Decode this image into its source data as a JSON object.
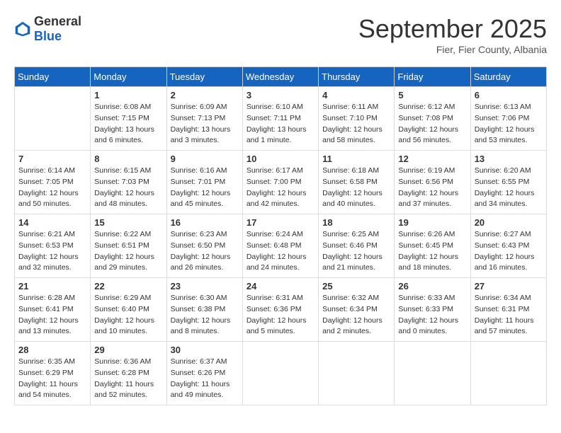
{
  "header": {
    "logo_general": "General",
    "logo_blue": "Blue",
    "month": "September 2025",
    "location": "Fier, Fier County, Albania"
  },
  "days_of_week": [
    "Sunday",
    "Monday",
    "Tuesday",
    "Wednesday",
    "Thursday",
    "Friday",
    "Saturday"
  ],
  "weeks": [
    [
      {
        "day": "",
        "info": ""
      },
      {
        "day": "1",
        "info": "Sunrise: 6:08 AM\nSunset: 7:15 PM\nDaylight: 13 hours\nand 6 minutes."
      },
      {
        "day": "2",
        "info": "Sunrise: 6:09 AM\nSunset: 7:13 PM\nDaylight: 13 hours\nand 3 minutes."
      },
      {
        "day": "3",
        "info": "Sunrise: 6:10 AM\nSunset: 7:11 PM\nDaylight: 13 hours\nand 1 minute."
      },
      {
        "day": "4",
        "info": "Sunrise: 6:11 AM\nSunset: 7:10 PM\nDaylight: 12 hours\nand 58 minutes."
      },
      {
        "day": "5",
        "info": "Sunrise: 6:12 AM\nSunset: 7:08 PM\nDaylight: 12 hours\nand 56 minutes."
      },
      {
        "day": "6",
        "info": "Sunrise: 6:13 AM\nSunset: 7:06 PM\nDaylight: 12 hours\nand 53 minutes."
      }
    ],
    [
      {
        "day": "7",
        "info": "Sunrise: 6:14 AM\nSunset: 7:05 PM\nDaylight: 12 hours\nand 50 minutes."
      },
      {
        "day": "8",
        "info": "Sunrise: 6:15 AM\nSunset: 7:03 PM\nDaylight: 12 hours\nand 48 minutes."
      },
      {
        "day": "9",
        "info": "Sunrise: 6:16 AM\nSunset: 7:01 PM\nDaylight: 12 hours\nand 45 minutes."
      },
      {
        "day": "10",
        "info": "Sunrise: 6:17 AM\nSunset: 7:00 PM\nDaylight: 12 hours\nand 42 minutes."
      },
      {
        "day": "11",
        "info": "Sunrise: 6:18 AM\nSunset: 6:58 PM\nDaylight: 12 hours\nand 40 minutes."
      },
      {
        "day": "12",
        "info": "Sunrise: 6:19 AM\nSunset: 6:56 PM\nDaylight: 12 hours\nand 37 minutes."
      },
      {
        "day": "13",
        "info": "Sunrise: 6:20 AM\nSunset: 6:55 PM\nDaylight: 12 hours\nand 34 minutes."
      }
    ],
    [
      {
        "day": "14",
        "info": "Sunrise: 6:21 AM\nSunset: 6:53 PM\nDaylight: 12 hours\nand 32 minutes."
      },
      {
        "day": "15",
        "info": "Sunrise: 6:22 AM\nSunset: 6:51 PM\nDaylight: 12 hours\nand 29 minutes."
      },
      {
        "day": "16",
        "info": "Sunrise: 6:23 AM\nSunset: 6:50 PM\nDaylight: 12 hours\nand 26 minutes."
      },
      {
        "day": "17",
        "info": "Sunrise: 6:24 AM\nSunset: 6:48 PM\nDaylight: 12 hours\nand 24 minutes."
      },
      {
        "day": "18",
        "info": "Sunrise: 6:25 AM\nSunset: 6:46 PM\nDaylight: 12 hours\nand 21 minutes."
      },
      {
        "day": "19",
        "info": "Sunrise: 6:26 AM\nSunset: 6:45 PM\nDaylight: 12 hours\nand 18 minutes."
      },
      {
        "day": "20",
        "info": "Sunrise: 6:27 AM\nSunset: 6:43 PM\nDaylight: 12 hours\nand 16 minutes."
      }
    ],
    [
      {
        "day": "21",
        "info": "Sunrise: 6:28 AM\nSunset: 6:41 PM\nDaylight: 12 hours\nand 13 minutes."
      },
      {
        "day": "22",
        "info": "Sunrise: 6:29 AM\nSunset: 6:40 PM\nDaylight: 12 hours\nand 10 minutes."
      },
      {
        "day": "23",
        "info": "Sunrise: 6:30 AM\nSunset: 6:38 PM\nDaylight: 12 hours\nand 8 minutes."
      },
      {
        "day": "24",
        "info": "Sunrise: 6:31 AM\nSunset: 6:36 PM\nDaylight: 12 hours\nand 5 minutes."
      },
      {
        "day": "25",
        "info": "Sunrise: 6:32 AM\nSunset: 6:34 PM\nDaylight: 12 hours\nand 2 minutes."
      },
      {
        "day": "26",
        "info": "Sunrise: 6:33 AM\nSunset: 6:33 PM\nDaylight: 12 hours\nand 0 minutes."
      },
      {
        "day": "27",
        "info": "Sunrise: 6:34 AM\nSunset: 6:31 PM\nDaylight: 11 hours\nand 57 minutes."
      }
    ],
    [
      {
        "day": "28",
        "info": "Sunrise: 6:35 AM\nSunset: 6:29 PM\nDaylight: 11 hours\nand 54 minutes."
      },
      {
        "day": "29",
        "info": "Sunrise: 6:36 AM\nSunset: 6:28 PM\nDaylight: 11 hours\nand 52 minutes."
      },
      {
        "day": "30",
        "info": "Sunrise: 6:37 AM\nSunset: 6:26 PM\nDaylight: 11 hours\nand 49 minutes."
      },
      {
        "day": "",
        "info": ""
      },
      {
        "day": "",
        "info": ""
      },
      {
        "day": "",
        "info": ""
      },
      {
        "day": "",
        "info": ""
      }
    ]
  ]
}
